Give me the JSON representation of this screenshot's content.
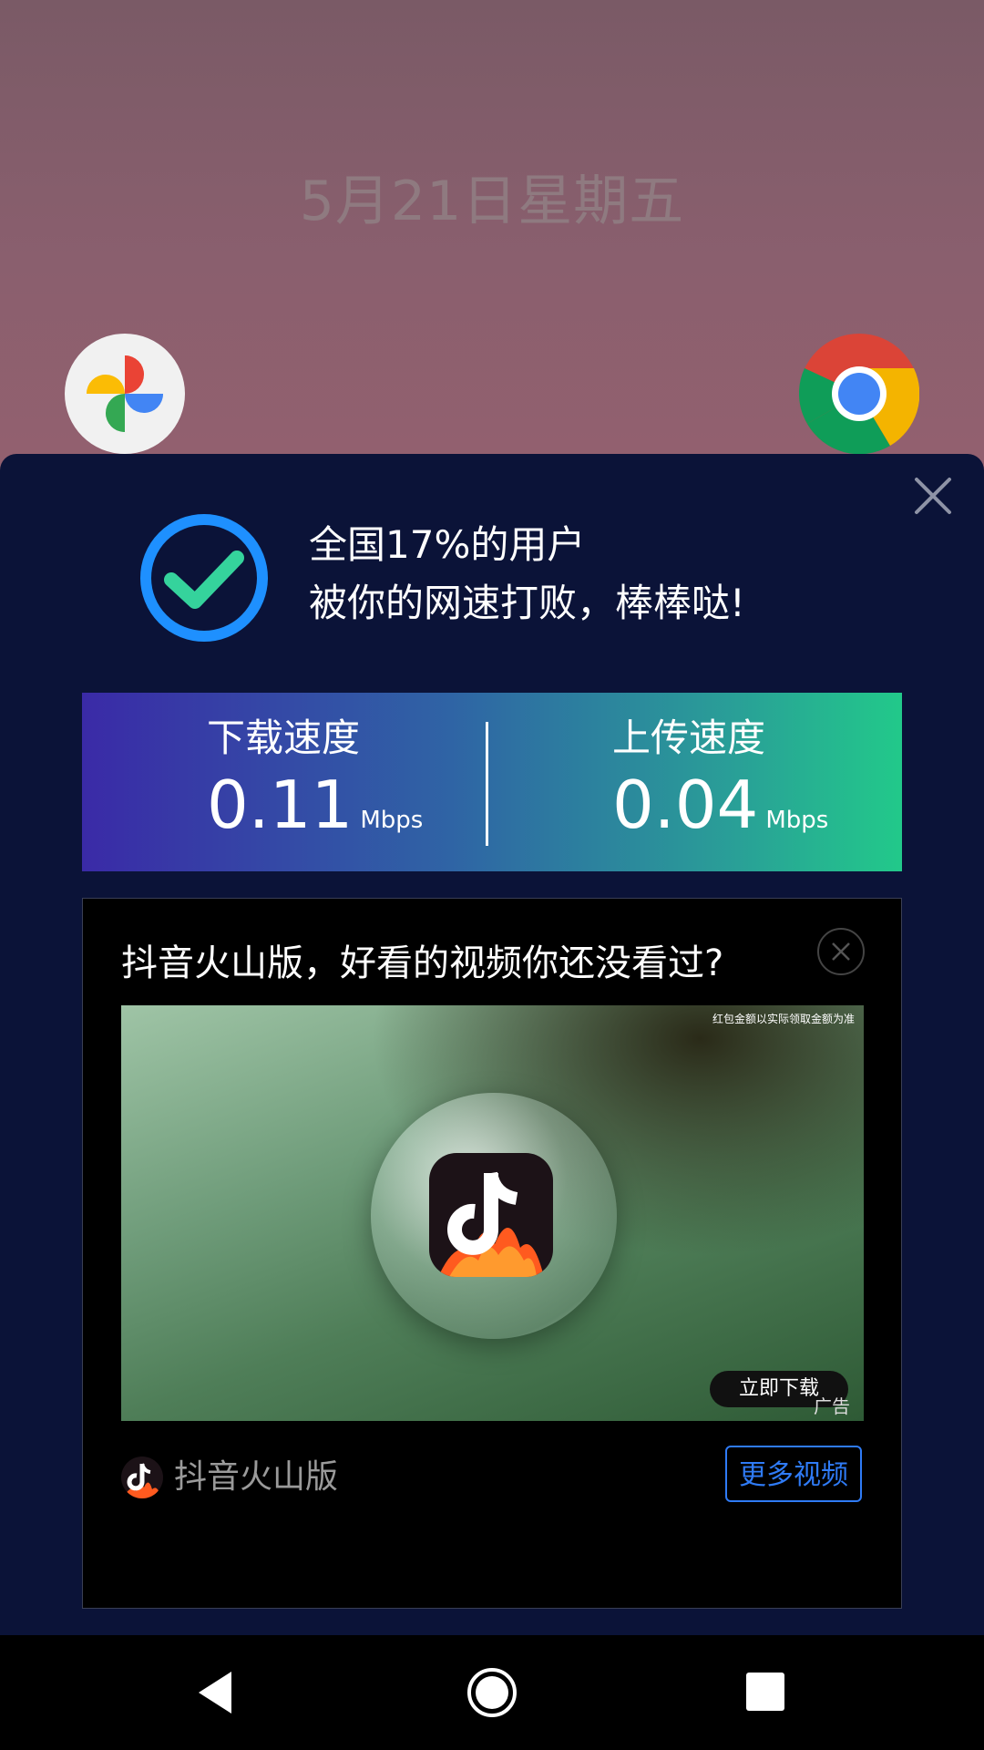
{
  "wallpaper": {
    "date": "5月21日星期五",
    "apps": [
      {
        "name": "Google Photos",
        "icon": "pinwheel-icon"
      },
      {
        "name": "Chrome",
        "icon": "chrome-icon"
      }
    ]
  },
  "result": {
    "line1": "全国17%的用户",
    "line2": "被你的网速打败，棒棒哒!"
  },
  "speed": {
    "download_label": "下载速度",
    "download_value": "0.11",
    "download_unit": "Mbps",
    "upload_label": "上传速度",
    "upload_value": "0.04",
    "upload_unit": "Mbps"
  },
  "ad": {
    "title": "抖音火山版，好看的视频你还没看过?",
    "note": "红包金额以实际领取金额为准",
    "download_label": "立即下载",
    "ad_label": "广告",
    "brand": "抖音火山版",
    "more_label": "更多视频"
  },
  "colors": {
    "panel": "#0b1338",
    "accent_blue": "#1e90ff",
    "check_green": "#35d39c",
    "button_blue": "#2f7bf6"
  }
}
